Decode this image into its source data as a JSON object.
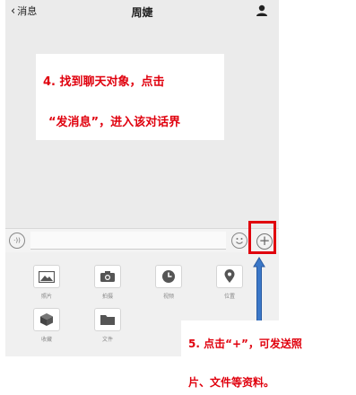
{
  "navbar": {
    "back_label": "消息",
    "title": "周婕"
  },
  "callout_step4": {
    "line1": "4. 找到聊天对象，点击",
    "line2": "“发消息”，进入该对话界"
  },
  "input_bar": {
    "voice_glyph": "·))",
    "plus_glyph": "+"
  },
  "panel": {
    "items": [
      {
        "label": "照片",
        "icon": "photo-icon"
      },
      {
        "label": "拍摄",
        "icon": "camera-icon"
      },
      {
        "label": "视频",
        "icon": "clock-icon"
      },
      {
        "label": "位置",
        "icon": "location-icon"
      },
      {
        "label": "收藏",
        "icon": "cube-icon"
      },
      {
        "label": "文件",
        "icon": "folder-icon"
      }
    ]
  },
  "callout_step5": {
    "line1": "5. 点击“+”，可发送照",
    "line2": "片、文件等资料。"
  },
  "colors": {
    "accent_red": "#e0000d",
    "arrow_blue": "#3b78c8"
  }
}
